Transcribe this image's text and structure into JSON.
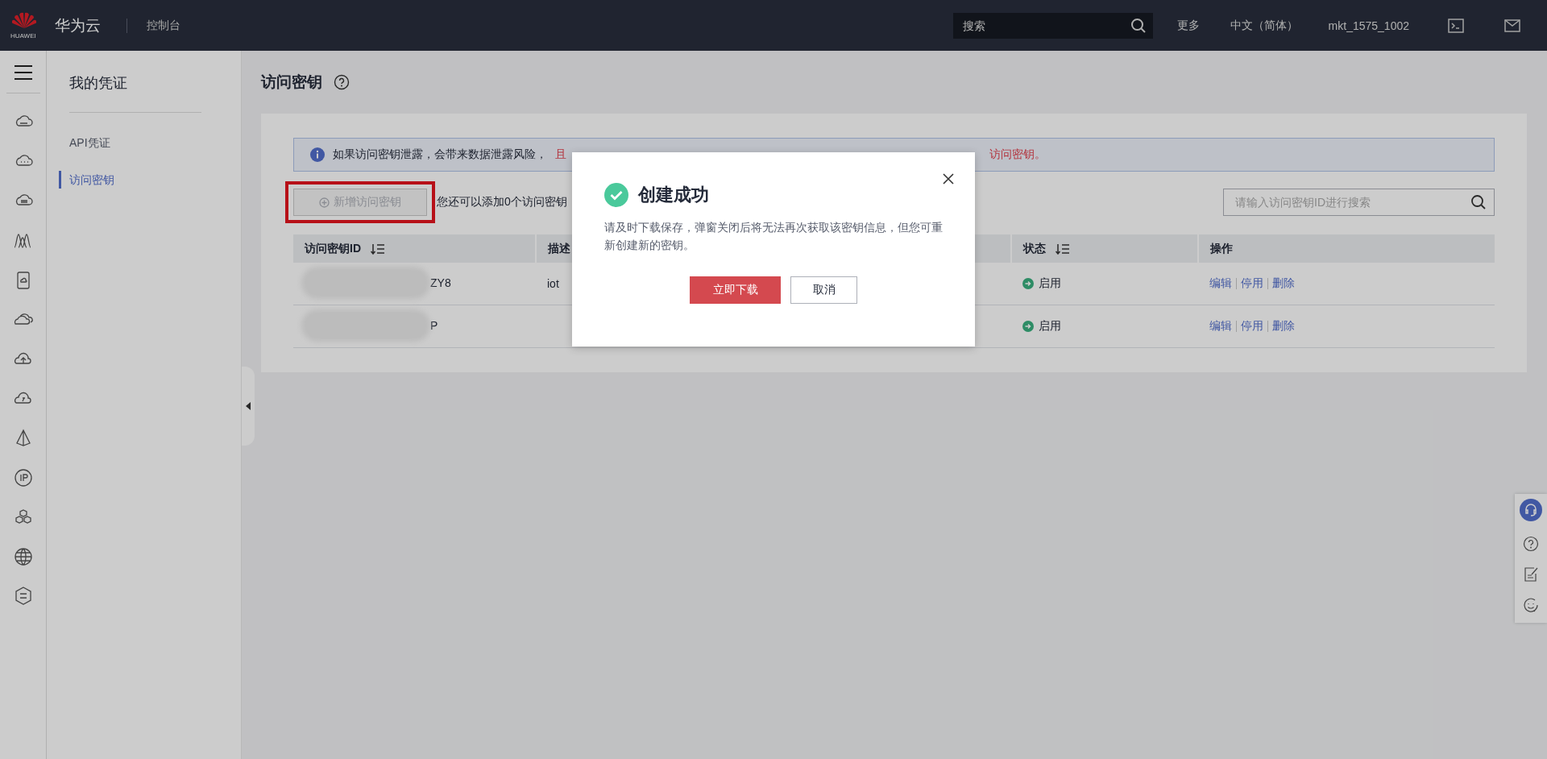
{
  "top_bar": {
    "logo_text": "HUAWEI",
    "brand": "华为云",
    "console": "控制台",
    "search": {
      "placeholder": "搜索"
    },
    "items": [
      "更多",
      "中文（简体）",
      "mkt_1575_1002"
    ]
  },
  "side_nav": {
    "title": "我的凭证",
    "items": [
      {
        "label": "API凭证",
        "selected": false
      },
      {
        "label": "访问密钥",
        "selected": true
      }
    ]
  },
  "page": {
    "title": "访问密钥",
    "alert": {
      "text": "如果访问密钥泄露，会带来数据泄露风险，",
      "warning_start": "且",
      "warning_end": "访问密钥。"
    },
    "add_button": {
      "label": "新增访问密钥",
      "disabled": true,
      "highlighted": true
    },
    "quota_text": "您还可以添加0个访问密钥",
    "search": {
      "placeholder": "请输入访问密钥ID进行搜索"
    },
    "table": {
      "columns": [
        {
          "label": "访问密钥ID",
          "sortable": true
        },
        {
          "label": "描述"
        },
        {
          "label": "状态",
          "sortable": true
        },
        {
          "label": "操作"
        }
      ],
      "rows": [
        {
          "id": "ZY8",
          "description": "iot",
          "status": "启用",
          "enabled": true,
          "actions": [
            "编辑",
            "停用",
            "删除"
          ]
        },
        {
          "id": "P",
          "status": "启用",
          "enabled": true,
          "actions": [
            "编辑",
            "停用",
            "删除"
          ]
        }
      ]
    }
  },
  "dialog": {
    "title": "创建成功",
    "message": "请及时下载保存，弹窗关闭后将无法再次获取该密钥信息，但您可重新创建新的密钥。",
    "primary": "立即下载",
    "secondary": "取消"
  }
}
